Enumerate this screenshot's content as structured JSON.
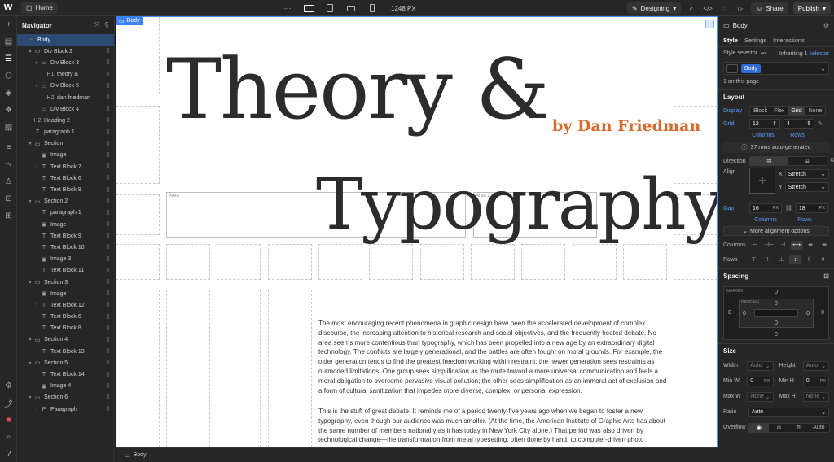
{
  "topbar": {
    "logo": "W",
    "home_label": "Home",
    "more": "···",
    "px_readout": "1248 PX",
    "mode_label": "Designing",
    "share_label": "Share",
    "publish_label": "Publish"
  },
  "navigator": {
    "title": "Navigator",
    "items": [
      {
        "label": "Body",
        "icon": "▭",
        "arrow": ""
      },
      {
        "label": "Div Block 2",
        "icon": "▭",
        "arrow": "▾"
      },
      {
        "label": "Div Block 3",
        "icon": "▭",
        "arrow": "▾"
      },
      {
        "label": "theory &",
        "icon": "H1",
        "arrow": ""
      },
      {
        "label": "Div Block 5",
        "icon": "▭",
        "arrow": "▾"
      },
      {
        "label": "dan friedman",
        "icon": "H2",
        "arrow": ""
      },
      {
        "label": "Div Block 4",
        "icon": "▭",
        "arrow": ""
      },
      {
        "label": "Heading 2",
        "icon": "H2",
        "arrow": ""
      },
      {
        "label": "paragraph 1",
        "icon": "T",
        "arrow": ""
      },
      {
        "label": "Section",
        "icon": "▭",
        "arrow": "▾"
      },
      {
        "label": "Image",
        "icon": "▣",
        "arrow": ""
      },
      {
        "label": "Text Block 7",
        "icon": "T",
        "arrow": "›"
      },
      {
        "label": "Text Block 6",
        "icon": "T",
        "arrow": ""
      },
      {
        "label": "Text Block 8",
        "icon": "T",
        "arrow": ""
      },
      {
        "label": "Section 2",
        "icon": "▭",
        "arrow": "▾"
      },
      {
        "label": "paragraph 1",
        "icon": "T",
        "arrow": ""
      },
      {
        "label": "Image",
        "icon": "▣",
        "arrow": ""
      },
      {
        "label": "Text Block 9",
        "icon": "T",
        "arrow": ""
      },
      {
        "label": "Text Block 10",
        "icon": "T",
        "arrow": ""
      },
      {
        "label": "Image 3",
        "icon": "▣",
        "arrow": ""
      },
      {
        "label": "Text Block 11",
        "icon": "T",
        "arrow": ""
      },
      {
        "label": "Section 3",
        "icon": "▭",
        "arrow": "▾"
      },
      {
        "label": "Image",
        "icon": "▣",
        "arrow": ""
      },
      {
        "label": "Text Block 12",
        "icon": "T",
        "arrow": "›"
      },
      {
        "label": "Text Block 6",
        "icon": "T",
        "arrow": ""
      },
      {
        "label": "Text Block 8",
        "icon": "T",
        "arrow": ""
      },
      {
        "label": "Section 4",
        "icon": "▭",
        "arrow": "▾"
      },
      {
        "label": "Text Block 13",
        "icon": "T",
        "arrow": ""
      },
      {
        "label": "Section 5",
        "icon": "▭",
        "arrow": "▾"
      },
      {
        "label": "Text Block 14",
        "icon": "T",
        "arrow": ""
      },
      {
        "label": "Image 4",
        "icon": "▣",
        "arrow": ""
      },
      {
        "label": "Section 6",
        "icon": "▭",
        "arrow": "▾"
      },
      {
        "label": "Paragraph",
        "icon": "P",
        "arrow": "›"
      }
    ]
  },
  "canvas": {
    "body_tag": "Body",
    "title_line1": "Theory &",
    "title_line2": "Typography",
    "byline": "by Dan Friedman",
    "area_label_1": "Area",
    "area_label_2": "Area 2",
    "paragraph_1": "The most encouraging recent phenomena in graphic design have been the accelerated development of complex discourse, the increasing attention to historical research and social objectives, and the frequently heated debate. No area seems more contentious than typography, which has been propelled into a new age by an extraordinary digital technology. The conflicts are largely generational, and the battles are often fought on moral grounds. For example, the older generation tends to find the greatest freedom working within restraint; the newer generation sees restraints as outmoded limitations. One group sees simplification as the route toward a more universal communication and feels a moral obligation to overcome pervasive visual pollution; the other sees simplification as an immoral act of exclusion and a form of cultural sanitization that impedes more diverse, complex, or personal expression.",
    "paragraph_2": "This is the stuff of great debate. It reminds me of a period twenty-five years ago when we began to foster a new typography, even though our audience was much smaller. (At the time, the American Institute of Graphic Arts has about the same number of members nationally as it has today in New York City alone.) That period was also driven by technological change—the transformation from metal typesetting, often done by hand, to computer-driven photo",
    "accent_color": "#d96a2b",
    "text_color": "#2c2c2c"
  },
  "bottombar": {
    "crumb": "Body"
  },
  "panel": {
    "element": "Body",
    "tabs": [
      "Style",
      "Settings",
      "Interactions"
    ],
    "style_selector_label": "Style selector",
    "inheriting": "Inheriting 1",
    "inheriting_link": "selector",
    "chip": "Body",
    "on_page": "1 on this page",
    "layout_title": "Layout",
    "display_label": "Display",
    "display_options": [
      "Block",
      "Flex",
      "Grid",
      "None"
    ],
    "grid_label": "Grid",
    "grid_columns": "12",
    "grid_rows": "4",
    "columns_label": "Columns",
    "rows_label": "Rows",
    "auto_rows_info": "37 rows auto-generated",
    "direction_label": "Direction",
    "align_label": "Align",
    "align_x_axis": "X",
    "align_x_value": "Stretch",
    "align_y_axis": "Y",
    "align_y_value": "Stretch",
    "gap_label": "Gap",
    "gap_col": "16",
    "gap_row": "18",
    "px_unit": "PX",
    "more_alignment": "More alignment options",
    "columns_row_label": "Columns",
    "rows_row_label": "Rows",
    "spacing_title": "Spacing",
    "margin_label": "MARGIN",
    "padding_label": "PADDING",
    "spacing_zero": "0",
    "size_title": "Size",
    "width_label": "Width",
    "height_label": "Height",
    "minw_label": "Min W",
    "minh_label": "Min H",
    "maxw_label": "Max W",
    "maxh_label": "Max H",
    "auto_value": "Auto",
    "none_value": "None",
    "zero_value": "0",
    "ratio_label": "Ratio",
    "ratio_value": "Auto",
    "overflow_label": "Overflow",
    "overflow_auto": "Auto"
  }
}
